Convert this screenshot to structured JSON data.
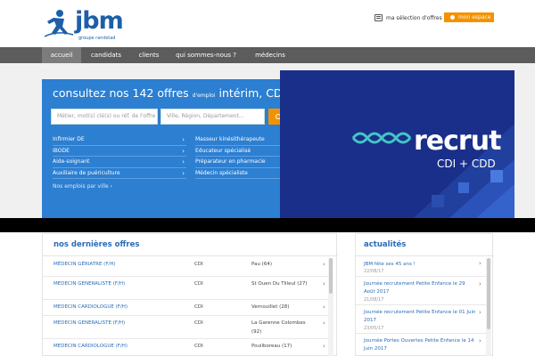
{
  "header": {
    "logo_text": "jbm",
    "logo_sub": "groupe randstad",
    "selection_label": "ma sélection d'offres",
    "account_label": "mon espace"
  },
  "nav": {
    "items": [
      "accueil",
      "candidats",
      "clients",
      "qui sommes-nous ?",
      "médecins"
    ],
    "active": "accueil"
  },
  "search": {
    "title_part1": "consultez nos 142 offres",
    "title_small": "d'emploi",
    "title_part2": "intérim, CDD et CDI",
    "keyword_placeholder": "Métier, mot(s) clé(s) ou réf. de l'offre",
    "location_placeholder": "Ville, Région, Département...",
    "button_label": "rechercher",
    "jobs_left": [
      "Infirmier DE",
      "IBODE",
      "Aide-soignant",
      "Auxiliaire de puériculture"
    ],
    "jobs_right": [
      "Masseur kinésithérapeute",
      "Educateur spécialisé",
      "Préparateur en pharmacie",
      "Médecin spécialiste"
    ],
    "more_link": "Nos emplois par ville"
  },
  "banner": {
    "word": "recrut",
    "sub": "CDI + CDD",
    "colors": {
      "background": "#1a2f8a",
      "accent": "#44c6c6"
    }
  },
  "offers": {
    "title": "nos dernières offres",
    "rows": [
      {
        "title": "MÉDECIN GÉRIATRE (F/H)",
        "type": "CDI",
        "location": "Pau (64)"
      },
      {
        "title": "MEDECIN GENERALISTE (F/H)",
        "type": "CDI",
        "location": "St Ouen Du Tilleul (27)"
      },
      {
        "title": "MEDECIN CARDIOLOGUE (F/H)",
        "type": "CDI",
        "location": "Vernouillet (28)"
      },
      {
        "title": "MEDECIN GENERALISTE (F/H)",
        "type": "CDI",
        "location": "La Garenne Colombes (92)"
      },
      {
        "title": "MEDECIN CARDIOLOGUE (F/H)",
        "type": "CDI",
        "location": "Pouilboreau (17)"
      }
    ]
  },
  "news": {
    "title": "actualités",
    "items": [
      {
        "title": "JBM fête ses 45 ans !",
        "date": "22/08/17"
      },
      {
        "title": "Journée recrutement Petite Enfance le 29 Août 2017",
        "date": "21/08/17"
      },
      {
        "title": "Journée recrutement Petite Enfance le 01 Juin 2017",
        "date": "23/05/17"
      },
      {
        "title": "Journée Portes Ouvertes Petite Enfance le 14 Juin 2017",
        "date": ""
      }
    ]
  },
  "colors": {
    "brand_blue": "#2c7fd1",
    "orange": "#f39200",
    "nav_bg": "#5c5c5c",
    "link_blue": "#2a6cb5"
  }
}
